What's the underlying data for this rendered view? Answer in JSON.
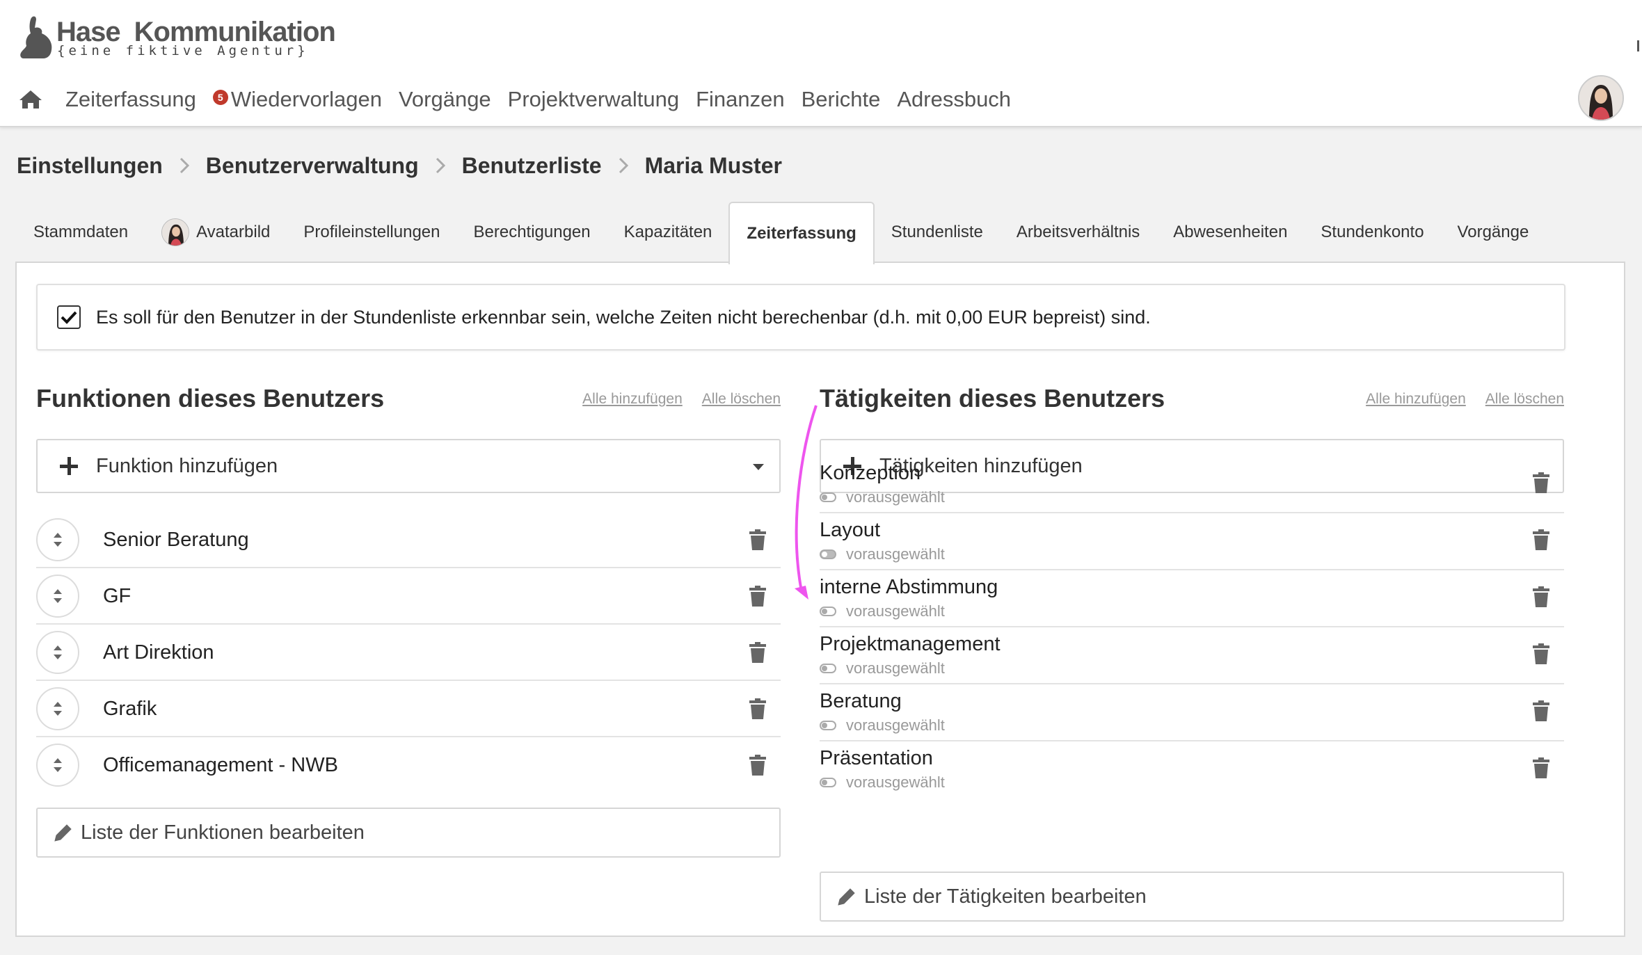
{
  "app": {
    "logo_title_1": "Hase",
    "logo_title_2": "Kommunikation",
    "logo_subtitle": "{eine fiktive Agentur}"
  },
  "nav": {
    "home_icon": "home-icon",
    "items": [
      {
        "label": "Zeiterfassung"
      },
      {
        "label": "Wiedervorlagen",
        "badge": "5"
      },
      {
        "label": "Vorgänge"
      },
      {
        "label": "Projektverwaltung"
      },
      {
        "label": "Finanzen"
      },
      {
        "label": "Berichte"
      },
      {
        "label": "Adressbuch"
      }
    ]
  },
  "breadcrumb": [
    "Einstellungen",
    "Benutzerverwaltung",
    "Benutzerliste",
    "Maria Muster"
  ],
  "tabs": [
    {
      "label": "Stammdaten"
    },
    {
      "label": "Avatarbild"
    },
    {
      "label": "Profileinstellungen"
    },
    {
      "label": "Berechtigungen"
    },
    {
      "label": "Kapazitäten"
    },
    {
      "label": "Zeiterfassung",
      "active": true
    },
    {
      "label": "Stundenliste"
    },
    {
      "label": "Arbeitsverhältnis"
    },
    {
      "label": "Abwesenheiten"
    },
    {
      "label": "Stundenkonto"
    },
    {
      "label": "Vorgänge"
    }
  ],
  "notice": {
    "checked": true,
    "text": "Es soll für den Benutzer in der Stundenliste erkennbar sein, welche Zeiten nicht berechenbar (d.h. mit 0,00 EUR bepreist) sind."
  },
  "functions": {
    "title": "Funktionen dieses Benutzers",
    "add_all": "Alle hinzufügen",
    "delete_all": "Alle löschen",
    "add_label": "Funktion hinzufügen",
    "items": [
      "Senior Beratung",
      "GF",
      "Art Direktion",
      "Grafik",
      "Officemanagement - NWB"
    ],
    "edit_label": "Liste der Funktionen bearbeiten"
  },
  "activities": {
    "title": "Tätigkeiten dieses Benutzers",
    "add_all": "Alle hinzufügen",
    "delete_all": "Alle löschen",
    "add_label": "Tätigkeiten hinzufügen",
    "preselected_label": "vorausgewählt",
    "items": [
      {
        "label": "Konzeption",
        "preselected": false
      },
      {
        "label": "Layout",
        "preselected": true
      },
      {
        "label": "interne Abstimmung",
        "preselected": false
      },
      {
        "label": "Projektmanagement",
        "preselected": false
      },
      {
        "label": "Beratung",
        "preselected": false
      },
      {
        "label": "Präsentation",
        "preselected": false
      }
    ],
    "edit_label": "Liste der Tätigkeiten bearbeiten"
  },
  "colors": {
    "accent_arrow": "#ee55ee",
    "badge": "#c0392b"
  }
}
